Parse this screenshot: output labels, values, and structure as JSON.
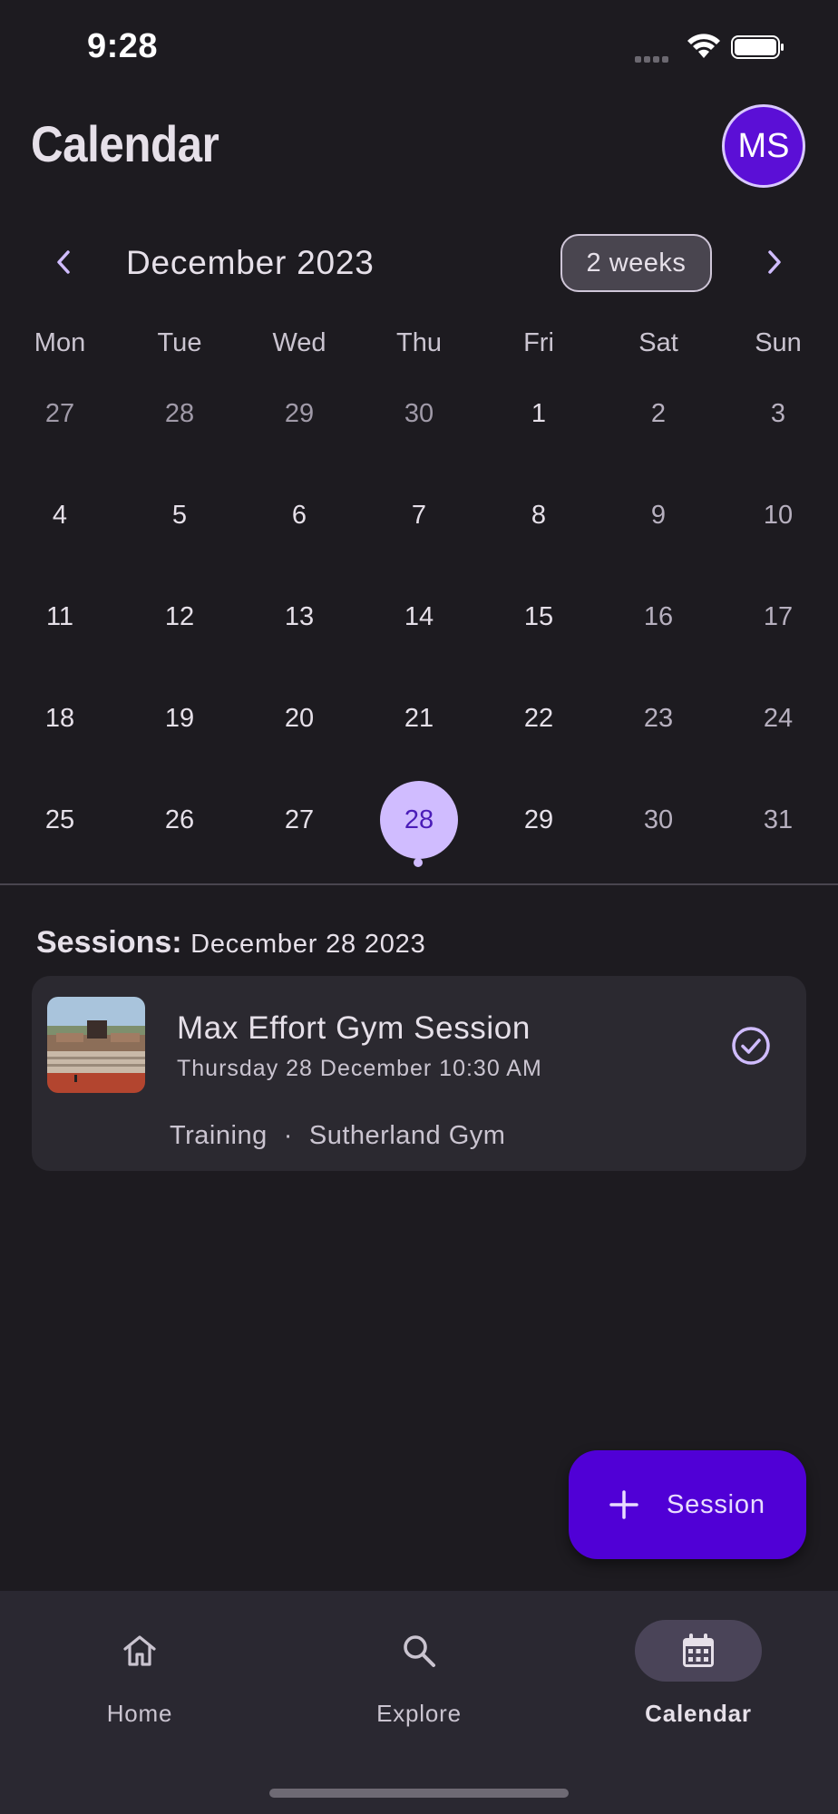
{
  "status_bar": {
    "time": "9:28"
  },
  "header": {
    "title": "Calendar",
    "avatar_initials": "MS"
  },
  "month_nav": {
    "month_label": "December 2023",
    "format_chip": "2 weeks"
  },
  "weekdays": [
    "Mon",
    "Tue",
    "Wed",
    "Thu",
    "Fri",
    "Sat",
    "Sun"
  ],
  "weeks": [
    [
      "27",
      "28",
      "29",
      "30",
      "1",
      "2",
      "3"
    ],
    [
      "4",
      "5",
      "6",
      "7",
      "8",
      "9",
      "10"
    ],
    [
      "11",
      "12",
      "13",
      "14",
      "15",
      "16",
      "17"
    ],
    [
      "18",
      "19",
      "20",
      "21",
      "22",
      "23",
      "24"
    ],
    [
      "25",
      "26",
      "27",
      "28",
      "29",
      "30",
      "31"
    ]
  ],
  "selected_day": "28",
  "sessions": {
    "label": "Sessions:",
    "date": "December 28 2023",
    "items": [
      {
        "title": "Max Effort Gym Session",
        "datetime": "Thursday 28 December 10:30 AM",
        "category": "Training",
        "separator": "·",
        "location": "Sutherland Gym",
        "completed": true
      }
    ]
  },
  "fab": {
    "label": "Session",
    "icon": "plus-icon"
  },
  "bottom_nav": [
    {
      "label": "Home",
      "icon": "home-icon",
      "active": false
    },
    {
      "label": "Explore",
      "icon": "search-icon",
      "active": false
    },
    {
      "label": "Calendar",
      "icon": "calendar-icon",
      "active": true
    }
  ],
  "colors": {
    "background": "#1d1b20",
    "accent": "#5000d6",
    "selected_day": "#d0bcff",
    "card": "#2b2930"
  }
}
